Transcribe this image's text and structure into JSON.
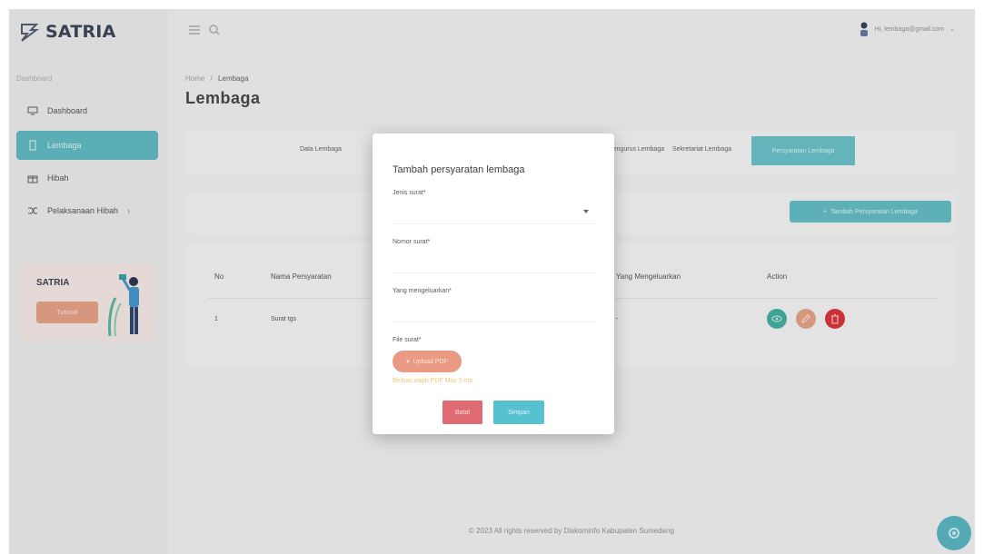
{
  "app": {
    "logo_text": "SATRIA"
  },
  "sidebar": {
    "section_label": "Dashboard",
    "items": [
      {
        "label": "Dashboard",
        "icon": "monitor-icon"
      },
      {
        "label": "Lembaga",
        "icon": "document-icon"
      },
      {
        "label": "Hibah",
        "icon": "gift-icon"
      },
      {
        "label": "Pelaksanaan Hibah",
        "icon": "shuffle-icon"
      }
    ],
    "promo": {
      "title": "SATRIA",
      "button_label": "Tutorial"
    }
  },
  "header": {
    "user_email": "Hi, lembaga@gmail.com"
  },
  "breadcrumb": {
    "home": "Home",
    "separator": "/",
    "current": "Lembaga"
  },
  "page_title": "Lembaga",
  "tabs": [
    {
      "label": "Data Lembaga"
    },
    {
      "label": "Pengurus Lembaga"
    },
    {
      "label": "Sekretariat Lembaga"
    },
    {
      "label": "Persyaratan Lembaga"
    }
  ],
  "actions": {
    "add_label": "Tambah Persyaratan Lembaga"
  },
  "table": {
    "columns": [
      "No",
      "Nama Persyaratan",
      "Yang Mengeluarkan",
      "Action"
    ],
    "rows": [
      {
        "no": "1",
        "nama": "Surat tgs",
        "mengeluarkan": "-"
      }
    ]
  },
  "footer": {
    "text": "© 2023 All rights reserved by Diskominfo Kabupaten Sumedang"
  },
  "modal": {
    "title": "Tambah persyaratan lembaga",
    "fields": {
      "jenis_label": "Jenis surat*",
      "nomor_label": "Nomor surat*",
      "yang_label": "Yang mengeluarkan*",
      "file_label": "File surat*"
    },
    "upload_label": "Upload PDF",
    "hint": "Berkas wajib PDF Max 5 mb",
    "cancel_label": "Batal",
    "save_label": "Simpan"
  },
  "colors": {
    "primary": "#57b6bf",
    "upload": "#ea9a82",
    "cancel": "#df6a73",
    "save": "#57c1cf",
    "hint": "#ecc877",
    "action_view": "#3aa89a",
    "action_edit": "#e29c7f",
    "action_delete": "#d6282e"
  }
}
